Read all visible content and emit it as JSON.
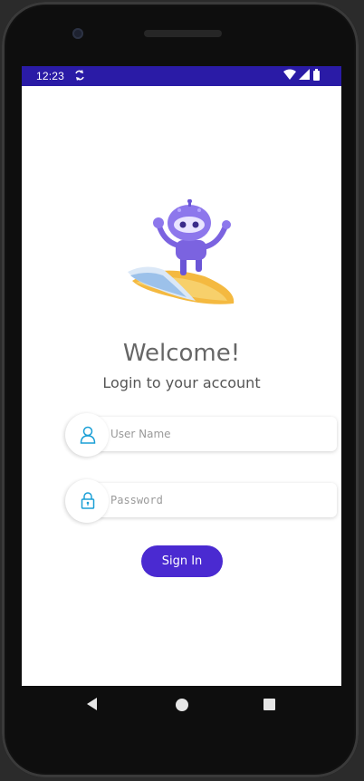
{
  "status_bar": {
    "time": "12:23",
    "background": "#2a1ba6",
    "icons": [
      "sync-icon",
      "wifi-icon",
      "signal-icon",
      "battery-icon"
    ]
  },
  "login": {
    "title": "Welcome!",
    "subtitle": "Login to your account",
    "username": {
      "placeholder": "User Name",
      "value": "",
      "icon": "user-icon"
    },
    "password": {
      "placeholder": "Password",
      "value": "",
      "icon": "lock-icon"
    },
    "sign_in_label": "Sign In",
    "accent_color": "#4a2ad1",
    "icon_color": "#1a9fd6"
  },
  "navigation": {
    "back": "back-icon",
    "home": "home-icon",
    "recents": "recents-icon"
  }
}
